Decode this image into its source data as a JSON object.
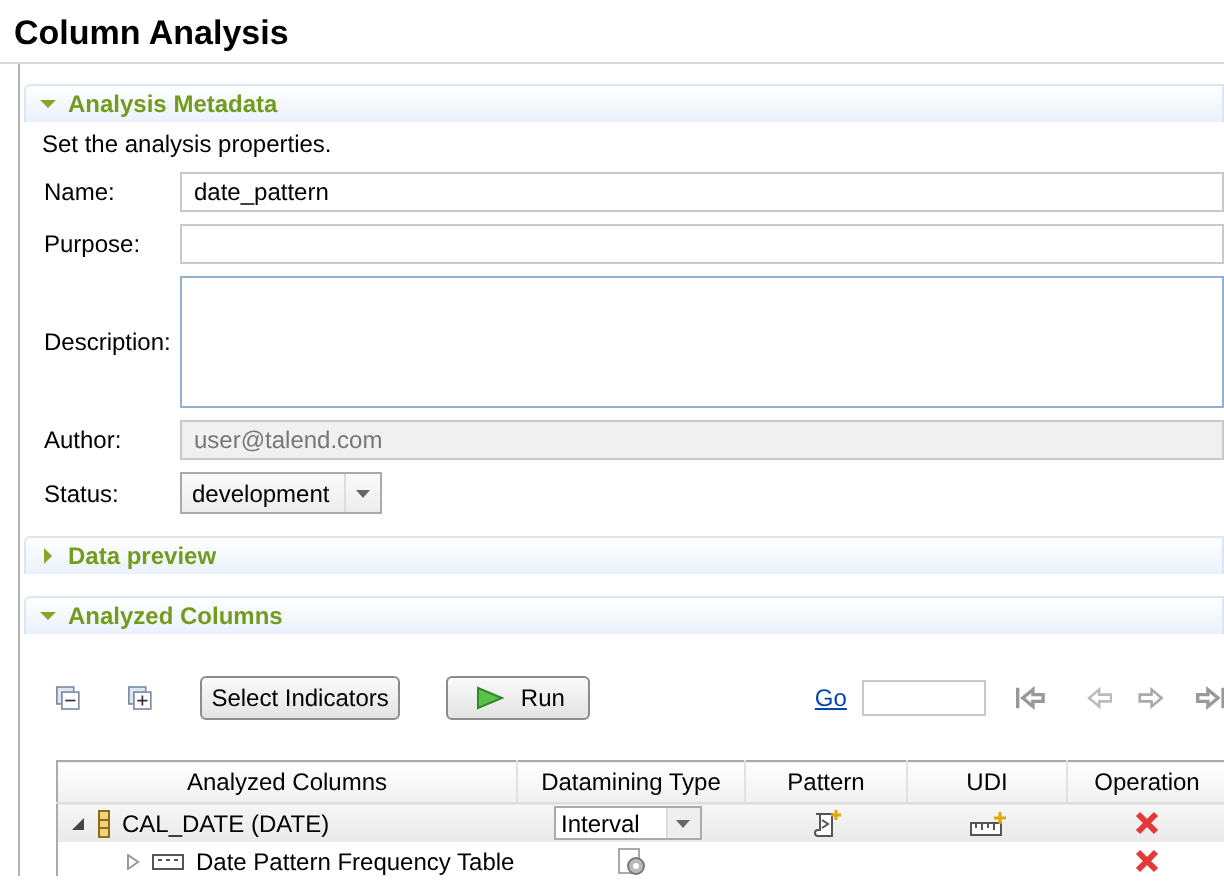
{
  "window": {
    "title": "Column Analysis"
  },
  "metadata_section": {
    "title": "Analysis Metadata",
    "expanded": true,
    "hint": "Set the analysis properties.",
    "fields": [
      {
        "kind": "text",
        "label": "Name:",
        "value": "date_pattern",
        "disabled": false
      },
      {
        "kind": "text",
        "label": "Purpose:",
        "disabled": false
      },
      {
        "kind": "textarea",
        "label": "Description:",
        "disabled": false
      },
      {
        "kind": "text",
        "label": "Author:",
        "value": "user@talend.com",
        "disabled": true
      },
      {
        "kind": "select",
        "label": "Status:",
        "value": "development",
        "disabled": false
      }
    ]
  },
  "data_preview_section": {
    "title": "Data preview",
    "expanded": false
  },
  "analyzed_columns_section": {
    "title": "Analyzed Columns",
    "expanded": true,
    "buttons": [
      "Select Indicators",
      "Run"
    ],
    "go_link": "Go",
    "table": {
      "columns": [
        "Analyzed Columns",
        "Datamining Type",
        "Pattern",
        "UDI",
        "Operation"
      ],
      "rows": [
        {
          "label": "CAL_DATE (DATE)",
          "expanded": true,
          "selected": true,
          "datamining_type": "Interval",
          "children": [
            {
              "label": "Date Pattern Frequency Table",
              "expanded": false,
              "selected": false
            }
          ]
        }
      ]
    }
  }
}
